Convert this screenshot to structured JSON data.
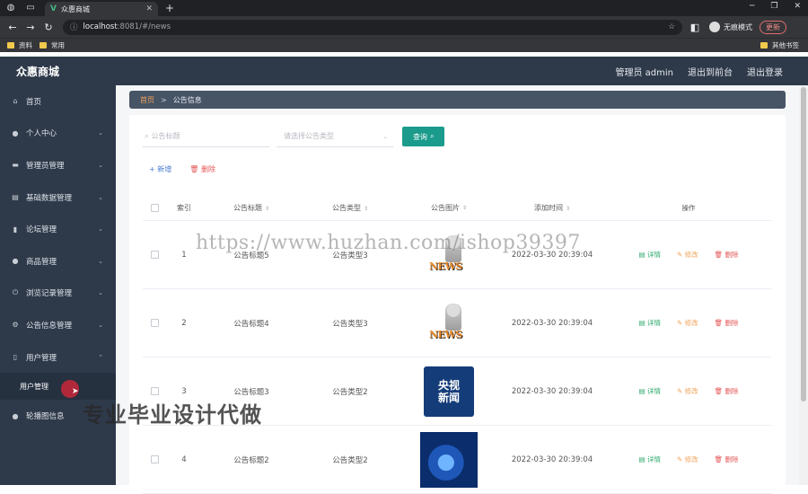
{
  "browser": {
    "tab_title": "众惠商城",
    "url_host": "localhost",
    "url_path": ":8081/#/news",
    "profile_label": "无痕模式",
    "update_label": "更新",
    "bookmarks": [
      "资料",
      "常用"
    ],
    "bookmarks_right": "其他书签"
  },
  "header": {
    "title": "众惠商城",
    "admin_label": "管理员 admin",
    "back_label": "退出到前台",
    "logout_label": "退出登录"
  },
  "sidebar": {
    "items": [
      {
        "label": "首页",
        "icon": "home-icon"
      },
      {
        "label": "个人中心",
        "icon": "user-icon"
      },
      {
        "label": "管理员管理",
        "icon": "grid-icon"
      },
      {
        "label": "基础数据管理",
        "icon": "doc-icon"
      },
      {
        "label": "论坛管理",
        "icon": "chart-icon"
      },
      {
        "label": "商品管理",
        "icon": "user-icon"
      },
      {
        "label": "浏览记录管理",
        "icon": "power-icon"
      },
      {
        "label": "公告信息管理",
        "icon": "gear-icon"
      },
      {
        "label": "用户管理",
        "icon": "phone-icon"
      }
    ],
    "sub_item": "用户管理",
    "last_item": "轮播图信息"
  },
  "breadcrumb": {
    "home": "首页",
    "sep": ">",
    "current": "公告信息"
  },
  "search": {
    "title_placeholder": "公告标题",
    "type_placeholder": "请选择公告类型",
    "query_label": "查询"
  },
  "actions": {
    "add_label": "+ 新增",
    "delete_label": "删除"
  },
  "table": {
    "headers": {
      "index": "索引",
      "title": "公告标题",
      "type": "公告类型",
      "pic": "公告图片",
      "time": "添加时间",
      "ops": "操作"
    },
    "op_labels": {
      "detail": "详情",
      "edit": "修改",
      "delete": "删除"
    },
    "rows": [
      {
        "index": "1",
        "title": "公告标题5",
        "type": "公告类型3",
        "pic": "news",
        "time": "2022-03-30 20:39:04"
      },
      {
        "index": "2",
        "title": "公告标题4",
        "type": "公告类型3",
        "pic": "news",
        "time": "2022-03-30 20:39:04"
      },
      {
        "index": "3",
        "title": "公告标题3",
        "type": "公告类型2",
        "pic": "cctv",
        "time": "2022-03-30 20:39:04"
      },
      {
        "index": "4",
        "title": "公告标题2",
        "type": "公告类型2",
        "pic": "blue",
        "time": "2022-03-30 20:39:04"
      }
    ],
    "news_pic_text": "NEWS",
    "cctv_pic_text": [
      "央视",
      "新闻"
    ]
  },
  "watermarks": {
    "url": "https://www.huzhan.com/ishop39397",
    "cn": "专业毕业设计代做"
  }
}
